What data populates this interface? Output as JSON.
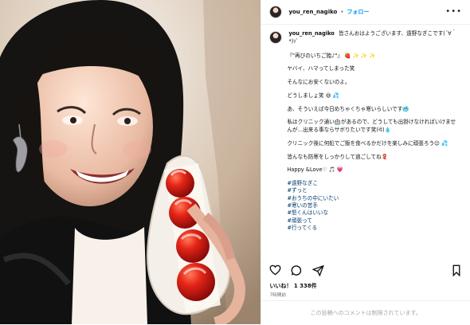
{
  "post": {
    "username": "you_ren_nagiko",
    "follow_label": "フォロー",
    "separator": "•",
    "more_label": "•••",
    "caption": {
      "intro": "皆さんおはようございます、遠野なぎこです(´∀｀*)ｿﾞ",
      "lines": [
        "『\"再びのいちご飴♪\"』 🍓 ✨ ✨ ✨",
        "ヤバイ、ハマってしまった笑",
        "そんなにお安くないのよ。",
        "どうしましょ笑 😆 💦",
        "あ、そういえば今日めちゃくちゃ寒いらしいです🥶",
        "私はクリニック通い🏥があるので、どうしても出掛けなければいけませんが…出来る事ならサボりたいです笑(ᐛ)💧",
        "クリニック後に何処でご飯を食べるかだけを楽しみに頑張ろう😊 💦",
        "皆んなも防寒をしっかりして過ごしてね🧣",
        "Happy &Love♡ 🎵 💗"
      ],
      "hashtags": [
        "#遠野なぎこ",
        "#ずっと",
        "#おうちの中にいたい",
        "#寒いの苦手",
        "#怒くんはいいな",
        "#頑張って",
        "#行ってくる"
      ]
    },
    "likes": "いいね！ 1 338件",
    "timestamp": "7時間前",
    "comments_disabled": "この投稿へのコメントは制限されています。",
    "icons": {
      "like": "heart-icon",
      "comment": "comment-icon",
      "share": "share-icon",
      "save": "bookmark-icon"
    }
  }
}
